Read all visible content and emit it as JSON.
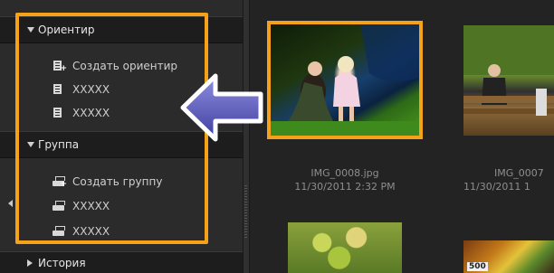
{
  "sidebar": {
    "sections": [
      {
        "title": "Ориентир",
        "expanded": true,
        "items": [
          {
            "label": "Создать ориентир",
            "icon": "add-bookmark-icon"
          },
          {
            "label": "XXXXX",
            "icon": "bookmark-icon"
          },
          {
            "label": "XXXXX",
            "icon": "bookmark-icon"
          }
        ]
      },
      {
        "title": "Группа",
        "expanded": true,
        "items": [
          {
            "label": "Создать группу",
            "icon": "add-group-icon"
          },
          {
            "label": "XXXXX",
            "icon": "group-icon"
          },
          {
            "label": "XXXXX",
            "icon": "group-icon"
          }
        ]
      },
      {
        "title": "История",
        "expanded": false,
        "items": []
      }
    ]
  },
  "thumbnails": [
    {
      "filename": "IMG_0008.jpg",
      "date": "11/30/2011 2:32 PM",
      "selected": true
    },
    {
      "filename": "IMG_0007",
      "date": "11/30/2011 1",
      "selected": false
    },
    {
      "filename": "",
      "date": "",
      "selected": false
    },
    {
      "filename": "",
      "date": "",
      "price_tag": "500",
      "selected": false
    }
  ],
  "colors": {
    "highlight": "#f5a21a",
    "arrow": "#5b5bb8",
    "panel": "#2b2b2b",
    "background": "#232323"
  }
}
